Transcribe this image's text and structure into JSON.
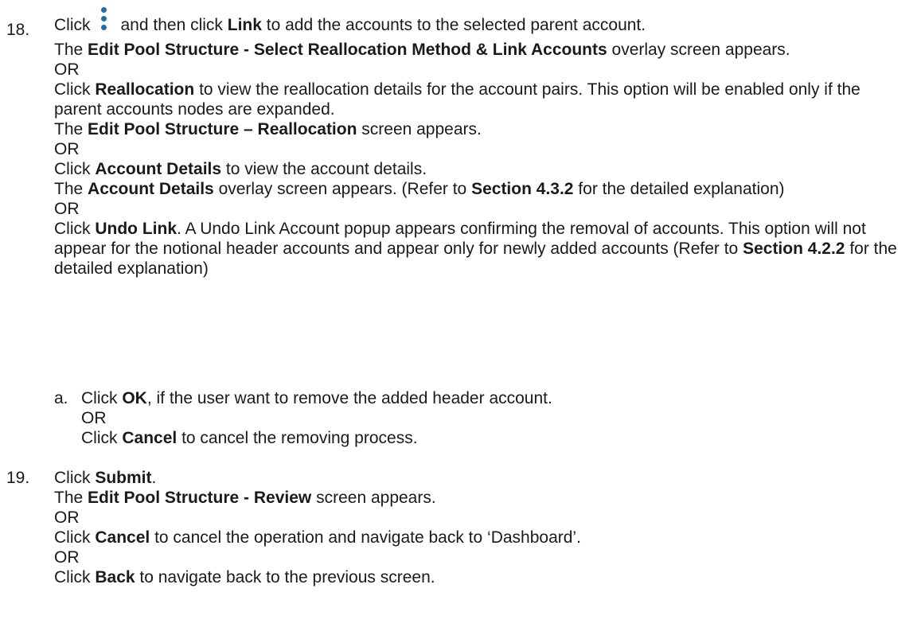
{
  "step18": {
    "number": "18.",
    "intro_a": "Click",
    "intro_b": "and then click",
    "intro_link": "Link",
    "intro_c": "to add the accounts to the selected parent account.",
    "icon": "kebab-menu-icon",
    "icon_color": "#1e6fa8",
    "p1_a": "The",
    "p1_bold": "Edit Pool Structure - Select Reallocation Method & Link Accounts",
    "p1_c": "overlay screen appears.",
    "or1": "OR",
    "p2_a": "Click",
    "p2_bold": "Reallocation",
    "p2_c": "to view the reallocation details for the account pairs. This option will be enabled only if the parent accounts nodes are expanded.",
    "p3_a": "The",
    "p3_bold": "Edit Pool Structure – Reallocation",
    "p3_c": "screen appears.",
    "or2": "OR",
    "p4_a": "Click",
    "p4_bold": "Account Details",
    "p4_c": "to view the account details.",
    "p5_a": "The",
    "p5_bold": "Account Details",
    "p5_c": "overlay screen appears. (Refer to",
    "p5_section": "Section 4.3.2",
    "p5_d": "for the detailed explanation)",
    "or3": "OR",
    "p6_a": "Click",
    "p6_bold": "Undo Link",
    "p6_c": ". A Undo Link Account popup appears confirming the removal of accounts. This option will not appear for the notional header accounts and appear only for newly added accounts (Refer to",
    "p6_section": "Section 4.2.2",
    "p6_d": "for the detailed explanation)",
    "sub": {
      "letter": "a.",
      "a_click": "Click",
      "a_ok": "OK",
      "a_rest": ", if the user want to remove the added header account.",
      "or": "OR",
      "b_click": "Click",
      "b_cancel": "Cancel",
      "b_rest": "to cancel the removing process."
    }
  },
  "step19": {
    "number": "19.",
    "p1_a": "Click",
    "p1_bold": "Submit",
    "p1_c": ".",
    "p2_a": "The",
    "p2_bold": "Edit Pool Structure - Review",
    "p2_c": "screen appears.",
    "or1": "OR",
    "p3_a": "Click",
    "p3_bold": "Cancel",
    "p3_c": "to cancel the operation and navigate back to ‘Dashboard’.",
    "or2": "OR",
    "p4_a": "Click",
    "p4_bold": "Back",
    "p4_c": "to navigate back to the previous screen."
  }
}
